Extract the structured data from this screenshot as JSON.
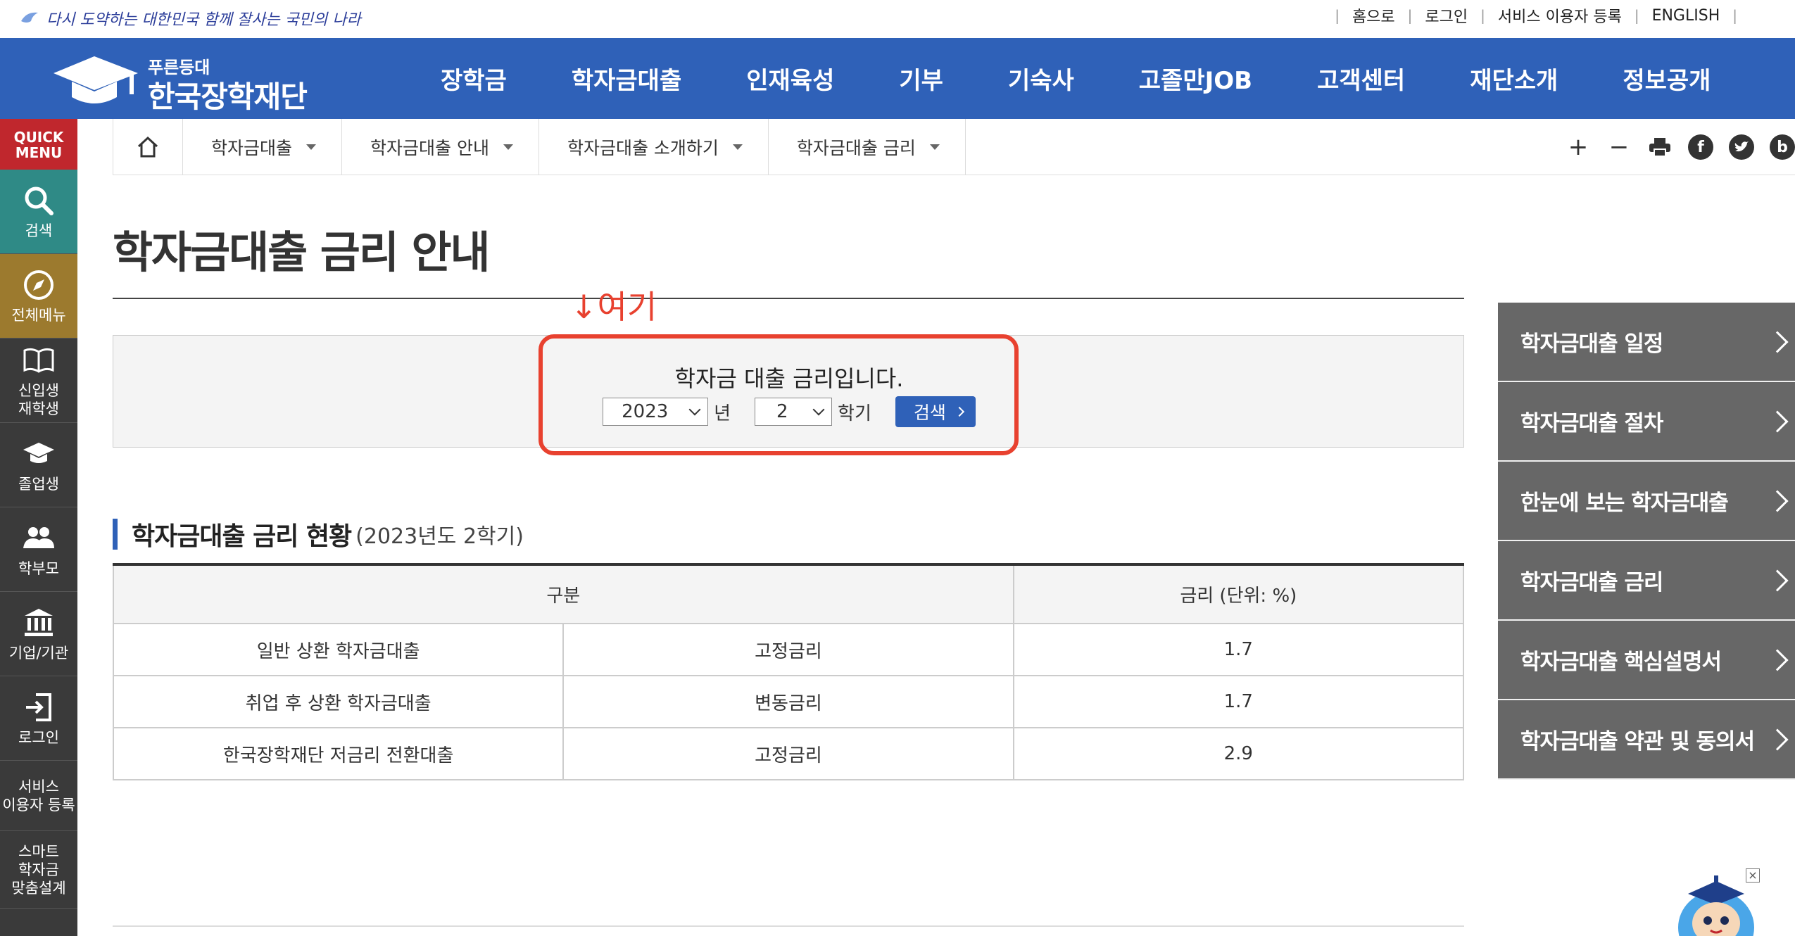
{
  "slogan": "다시 도약하는 대한민국 함께 잘사는 국민의 나라",
  "util_links": [
    "홈으로",
    "로그인",
    "서비스 이용자 등록",
    "ENGLISH"
  ],
  "logo": {
    "sub": "푸른등대",
    "main": "한국장학재단"
  },
  "gnb": [
    "장학금",
    "학자금대출",
    "인재육성",
    "기부",
    "기숙사",
    "고졸만JOB",
    "고객센터",
    "재단소개",
    "정보공개"
  ],
  "quick_menu": {
    "title_line1": "QUICK",
    "title_line2": "MENU",
    "items": [
      {
        "label": "검색",
        "icon": "search-icon"
      },
      {
        "label": "전체메뉴",
        "icon": "compass-icon"
      },
      {
        "label": "신입생\n재학생",
        "icon": "book-icon"
      },
      {
        "label": "졸업생",
        "icon": "graduation-cap-icon"
      },
      {
        "label": "학부모",
        "icon": "parents-icon"
      },
      {
        "label": "기업/기관",
        "icon": "building-icon"
      },
      {
        "label": "로그인",
        "icon": "login-icon"
      },
      {
        "label": "서비스\n이용자 등록",
        "icon": ""
      },
      {
        "label": "스마트\n학자금\n맞춤설계",
        "icon": ""
      }
    ]
  },
  "breadcrumb": [
    "학자금대출",
    "학자금대출 안내",
    "학자금대출 소개하기",
    "학자금대출 금리"
  ],
  "tools": {
    "zoom_in": "+",
    "zoom_out": "−",
    "facebook": "f",
    "blog": "b"
  },
  "page_title": "학자금대출 금리 안내",
  "annotation": "↓여기",
  "search": {
    "message": "학자금 대출 금리입니다.",
    "year_value": "2023",
    "year_unit": "년",
    "term_value": "2",
    "term_unit": "학기",
    "button_label": "검색"
  },
  "section": {
    "title": "학자금대출 금리 현황",
    "subtitle": "(2023년도 2학기)"
  },
  "table": {
    "headers": [
      "구분",
      "금리 (단위: %)"
    ],
    "rows": [
      [
        "일반 상환 학자금대출",
        "고정금리",
        "1.7"
      ],
      [
        "취업 후 상환 학자금대출",
        "변동금리",
        "1.7"
      ],
      [
        "한국장학재단 저금리 전환대출",
        "고정금리",
        "2.9"
      ]
    ]
  },
  "side_menu": [
    "학자금대출 일정",
    "학자금대출 절차",
    "한눈에 보는 학자금대출",
    "학자금대출 금리",
    "학자금대출 핵심설명서",
    "학자금대출 약관 및 동의서"
  ],
  "colors": {
    "brand_blue": "#2f61b8",
    "quick_red": "#c0272d",
    "side_gray": "#676767",
    "highlight_red": "#e8412f"
  }
}
